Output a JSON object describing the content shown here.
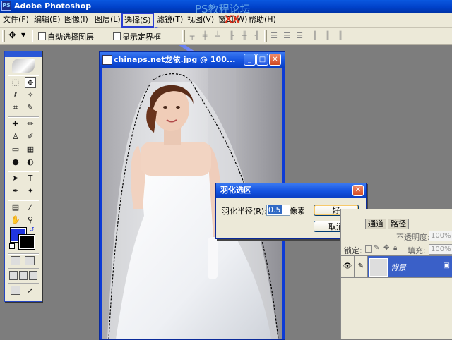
{
  "app": {
    "title": "Adobe Photoshop",
    "icon_text": "PS"
  },
  "watermark": {
    "text": "PS教程论坛",
    "mark": "XX"
  },
  "menu": [
    {
      "label": "文件(F)"
    },
    {
      "label": "编辑(E)"
    },
    {
      "label": "图像(I)"
    },
    {
      "label": "图层(L)"
    },
    {
      "label": "选择(S)",
      "highlighted": true
    },
    {
      "label": "滤镜(T)"
    },
    {
      "label": "视图(V)"
    },
    {
      "label": "窗口(W)"
    },
    {
      "label": "帮助(H)"
    }
  ],
  "options": {
    "auto_select_label": "自动选择图层",
    "show_bounds_label": "显示定界框"
  },
  "document": {
    "title": "chinaps.net龙依.jpg @ 100..."
  },
  "dialog": {
    "title": "羽化选区",
    "radius_label": "羽化半径(R):",
    "radius_value": "0.5",
    "unit": "像素",
    "ok_label": "好",
    "cancel_label": "取消"
  },
  "layers_panel": {
    "tabs": [
      "通道",
      "路径"
    ],
    "opacity_label": "不透明度:",
    "opacity_value": "100%",
    "lock_label": "锁定:",
    "fill_label": "填充:",
    "fill_value": "100%",
    "layer_name": "背景"
  },
  "colors": {
    "foreground": "#2035e0",
    "background": "#000000",
    "accent": "#0a58e0"
  }
}
